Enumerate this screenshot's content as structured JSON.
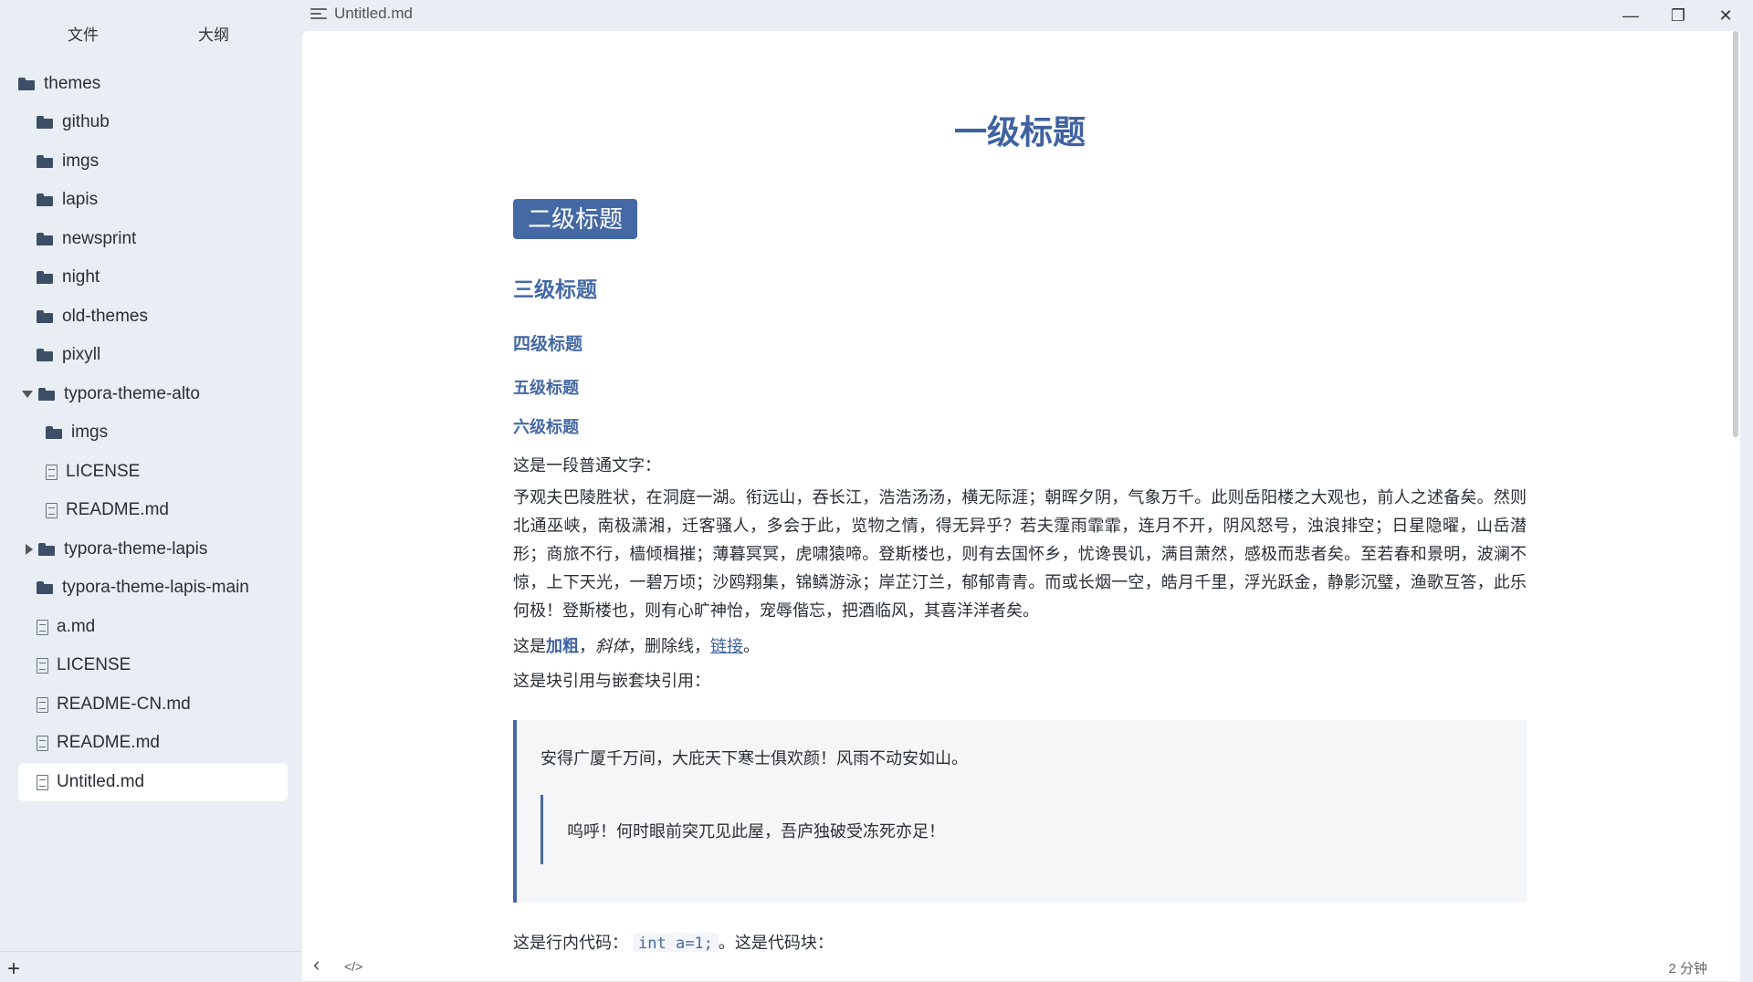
{
  "window": {
    "doc_title": "Untitled.md",
    "minimize": "—",
    "maximize": "❐",
    "close": "✕"
  },
  "sidebar": {
    "tabs": [
      "文件",
      "大纲"
    ],
    "tree": [
      {
        "label": "themes",
        "type": "folder"
      },
      {
        "label": "github",
        "type": "folder"
      },
      {
        "label": "imgs",
        "type": "folder"
      },
      {
        "label": "lapis",
        "type": "folder"
      },
      {
        "label": "newsprint",
        "type": "folder"
      },
      {
        "label": "night",
        "type": "folder"
      },
      {
        "label": "old-themes",
        "type": "folder"
      },
      {
        "label": "pixyll",
        "type": "folder"
      },
      {
        "label": "typora-theme-alto",
        "type": "folder",
        "expanded": true
      },
      {
        "label": "imgs",
        "type": "folder"
      },
      {
        "label": "LICENSE",
        "type": "file"
      },
      {
        "label": "README.md",
        "type": "file"
      },
      {
        "label": "typora-theme-lapis",
        "type": "folder",
        "expanded": false
      },
      {
        "label": "typora-theme-lapis-main",
        "type": "folder"
      },
      {
        "label": "a.md",
        "type": "file"
      },
      {
        "label": "LICENSE",
        "type": "file"
      },
      {
        "label": "README-CN.md",
        "type": "file"
      },
      {
        "label": "README.md",
        "type": "file"
      },
      {
        "label": "Untitled.md",
        "type": "file",
        "active": true
      }
    ],
    "add_label": "+"
  },
  "document": {
    "h1": "一级标题",
    "h2": "二级标题",
    "h3": "三级标题",
    "h4": "四级标题",
    "h5": "五级标题",
    "h6": "六级标题",
    "intro": "这是一段普通文字：",
    "long_paragraph": "予观夫巴陵胜状，在洞庭一湖。衔远山，吞长江，浩浩汤汤，横无际涯；朝晖夕阴，气象万千。此则岳阳楼之大观也，前人之述备矣。然则北通巫峡，南极潇湘，迁客骚人，多会于此，览物之情，得无异乎？若夫霪雨霏霏，连月不开，阴风怒号，浊浪排空；日星隐曜，山岳潜形；商旅不行，樯倾楫摧；薄暮冥冥，虎啸猿啼。登斯楼也，则有去国怀乡，忧谗畏讥，满目萧然，感极而悲者矣。至若春和景明，波澜不惊，上下天光，一碧万顷；沙鸥翔集，锦鳞游泳；岸芷汀兰，郁郁青青。而或长烟一空，皓月千里，浮光跃金，静影沉璧，渔歌互答，此乐何极！登斯楼也，则有心旷神怡，宠辱偕忘，把酒临风，其喜洋洋者矣。",
    "format_prefix": "这是",
    "bold": "加粗",
    "sep1": "，",
    "italic": "斜体",
    "sep2": "，删除线，",
    "link": "链接",
    "end": "。",
    "quote_intro": "这是块引用与嵌套块引用：",
    "quote": "安得广厦千万间，大庇天下寒士俱欢颜！风雨不动安如山。",
    "nested_quote": "呜呼！何时眼前突兀见此屋，吾庐独破受冻死亦足！",
    "code_prefix": "这是行内代码：",
    "inline_code": "int a=1;",
    "code_suffix": "。这是代码块："
  },
  "footer": {
    "back": "‹",
    "source": "</>",
    "word_count": "2 分钟"
  }
}
